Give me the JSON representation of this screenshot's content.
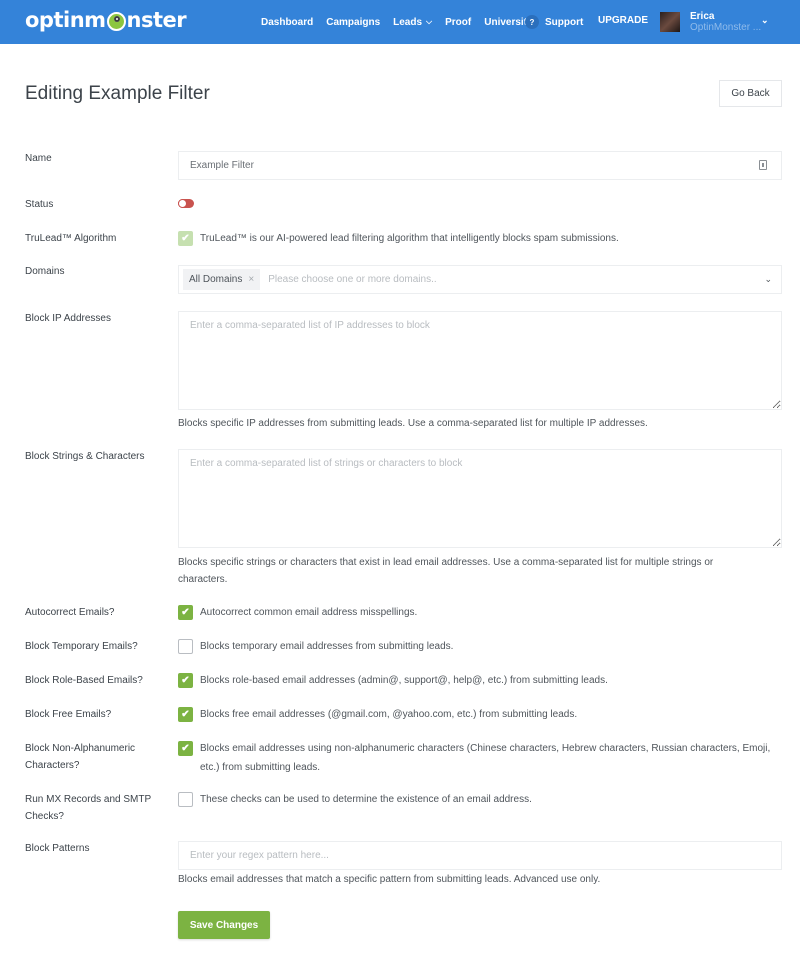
{
  "app": {
    "brand": {
      "text_before": "optinm",
      "text_after": "nster",
      "mascot_icon": "monster-logo-icon"
    },
    "colors": {
      "nav_bg": "#3483d9",
      "accent_green": "#7cb342",
      "toggle_off": "#c9534f"
    }
  },
  "nav": {
    "items": [
      {
        "label": "Dashboard"
      },
      {
        "label": "Campaigns"
      },
      {
        "label": "Leads",
        "has_dropdown": true
      },
      {
        "label": "Proof"
      },
      {
        "label": "University"
      }
    ],
    "support": {
      "icon": "?",
      "label": "Support"
    },
    "upgrade": "UPGRADE",
    "user": {
      "name": "Erica",
      "org": "OptinMonster ..."
    }
  },
  "header": {
    "title": "Editing Example Filter",
    "go_back": "Go Back"
  },
  "form": {
    "name": {
      "label": "Name",
      "value": "Example Filter"
    },
    "status": {
      "label": "Status",
      "enabled": false
    },
    "trulead": {
      "label": "TruLead™ Algorithm",
      "checked": true,
      "disabled": true,
      "text": "TruLead™ is our AI-powered lead filtering algorithm that intelligently blocks spam submissions."
    },
    "domains": {
      "label": "Domains",
      "selected": [
        "All Domains"
      ],
      "placeholder": "Please choose one or more domains..",
      "remove_icon": "×",
      "chevron": "⌄"
    },
    "block_ip": {
      "label": "Block IP Addresses",
      "placeholder": "Enter a comma-separated list of IP addresses to block",
      "value": "",
      "help": "Blocks specific IP addresses from submitting leads. Use a comma-separated list for multiple IP addresses."
    },
    "block_strings": {
      "label": "Block Strings & Characters",
      "placeholder": "Enter a comma-separated list of strings or characters to block",
      "value": "",
      "help": "Blocks specific strings or characters that exist in lead email addresses. Use a comma-separated list for multiple strings or characters."
    },
    "autocorrect": {
      "label": "Autocorrect Emails?",
      "checked": true,
      "text": "Autocorrect common email address misspellings."
    },
    "block_temporary": {
      "label": "Block Temporary Emails?",
      "checked": false,
      "text": "Blocks temporary email addresses from submitting leads."
    },
    "block_role": {
      "label": "Block Role-Based Emails?",
      "checked": true,
      "text": "Blocks role-based email addresses (admin@, support@, help@, etc.) from submitting leads."
    },
    "block_free": {
      "label": "Block Free Emails?",
      "checked": true,
      "text": "Blocks free email addresses (@gmail.com, @yahoo.com, etc.) from submitting leads."
    },
    "block_nonalpha": {
      "label": "Block Non-Alphanumeric Characters?",
      "checked": true,
      "text": "Blocks email addresses using non-alphanumeric characters (Chinese characters, Hebrew characters, Russian characters, Emoji, etc.) from submitting leads."
    },
    "mx_smtp": {
      "label": "Run MX Records and SMTP Checks?",
      "checked": false,
      "text": "These checks can be used to determine the existence of an email address."
    },
    "block_patterns": {
      "label": "Block Patterns",
      "placeholder": "Enter your regex pattern here...",
      "value": "",
      "help": "Blocks email addresses that match a specific pattern from submitting leads. Advanced use only."
    },
    "save": "Save Changes",
    "check_glyph": "✔"
  }
}
